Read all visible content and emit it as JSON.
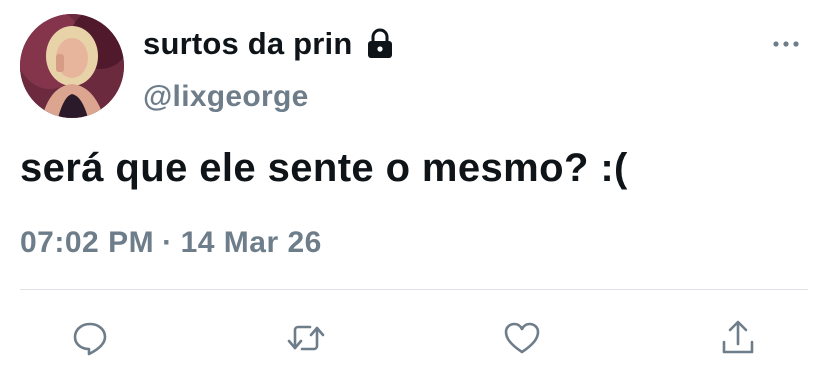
{
  "user": {
    "display_name": "surtos da prin",
    "handle": "@lixgeorge",
    "protected_icon": "lock-icon",
    "avatar": "profile-photo"
  },
  "tweet": {
    "text": "será que ele sente o mesmo? :("
  },
  "meta": {
    "time": "07:02 PM",
    "separator": "·",
    "date": "14 Mar 26"
  },
  "actions": [
    {
      "icon": "reply-icon"
    },
    {
      "icon": "retweet-icon"
    },
    {
      "icon": "like-icon"
    },
    {
      "icon": "share-icon"
    }
  ],
  "colors": {
    "text_primary": "#0f1419",
    "text_secondary": "#6e7d8a",
    "divider": "#dfe3e7"
  }
}
